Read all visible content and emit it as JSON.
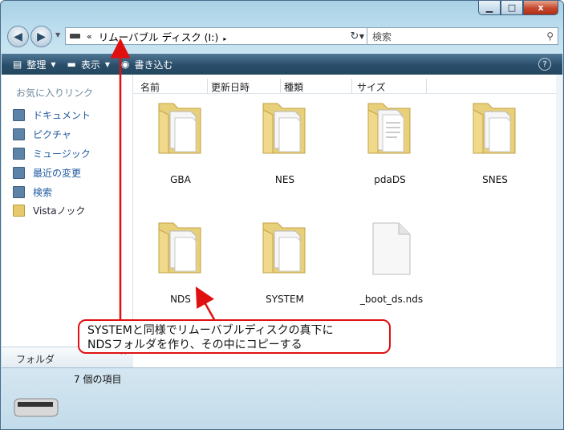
{
  "window": {
    "minimize_icon": "minimize-icon",
    "maximize_icon": "maximize-icon",
    "close_label": "x"
  },
  "nav": {
    "address_chevron": "«",
    "address_path": "リムーバブル ディスク (I:)",
    "address_separator": "▸",
    "search_placeholder": "検索"
  },
  "toolbar": {
    "organize_label": "整理",
    "views_label": "表示",
    "burn_label": "書き込む"
  },
  "sidebar": {
    "favorites_title": "お気に入りリンク",
    "items": [
      {
        "label": "ドキュメント",
        "icon": "documents-icon"
      },
      {
        "label": "ピクチャ",
        "icon": "pictures-icon"
      },
      {
        "label": "ミュージック",
        "icon": "music-icon"
      },
      {
        "label": "最近の変更",
        "icon": "recent-icon"
      },
      {
        "label": "検索",
        "icon": "search-folder-icon"
      },
      {
        "label": "Vistaノック",
        "icon": "folder-icon"
      }
    ],
    "folders_label": "フォルダ",
    "folders_toggle": "^"
  },
  "columns": [
    "名前",
    "更新日時",
    "種類",
    "サイズ"
  ],
  "files": [
    {
      "name": "GBA",
      "type": "folder"
    },
    {
      "name": "NES",
      "type": "folder"
    },
    {
      "name": "pdaDS",
      "type": "folder"
    },
    {
      "name": "SNES",
      "type": "folder"
    },
    {
      "name": "NDS",
      "type": "folder"
    },
    {
      "name": "SYSTEM",
      "type": "folder"
    },
    {
      "name": "_boot_ds.nds",
      "type": "file"
    }
  ],
  "status": {
    "item_count": "7 個の項目"
  },
  "annotation": {
    "line1": "SYSTEMと同様でリムーバブルディスクの真下に",
    "line2": "NDSフォルダを作り、その中にコピーする",
    "color": "#e01010"
  }
}
